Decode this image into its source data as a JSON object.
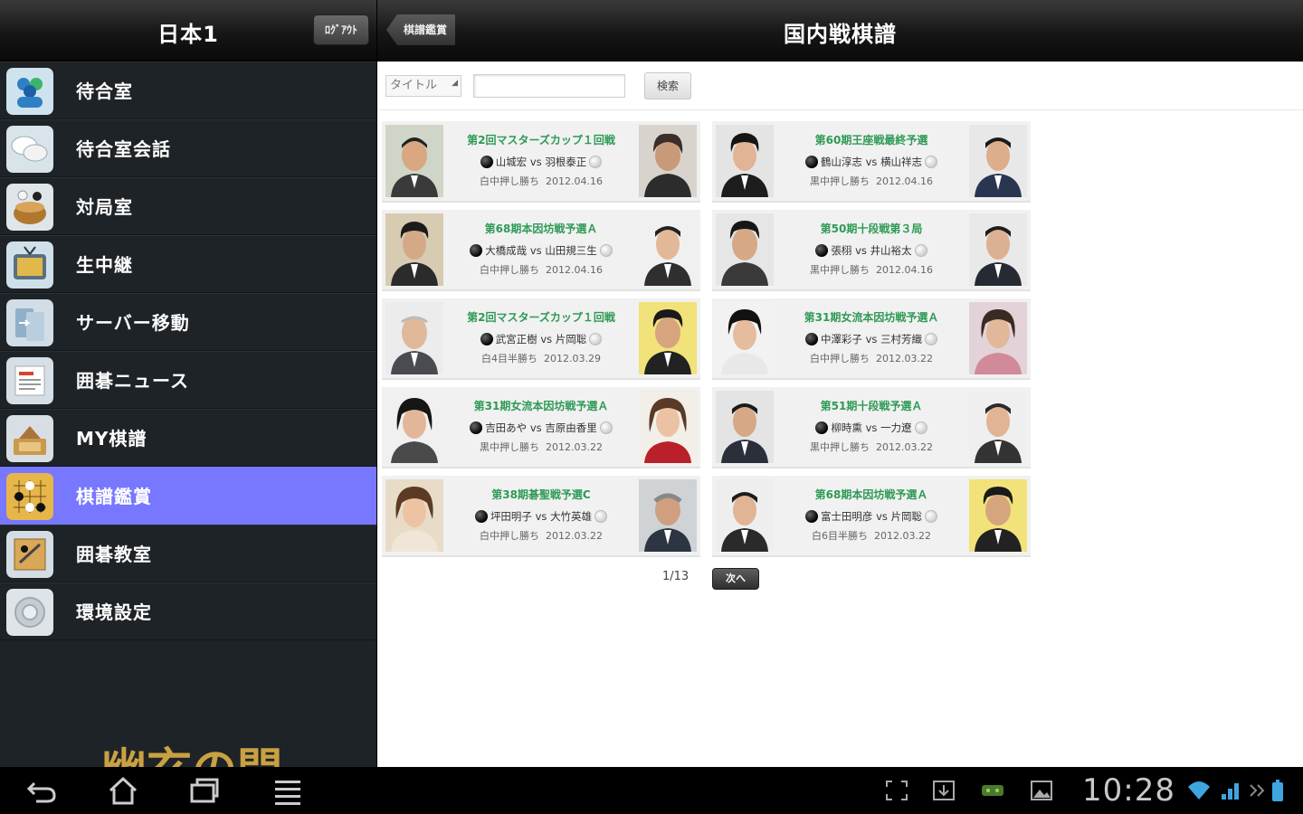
{
  "left_header": {
    "title": "日本1",
    "logout_label": "ﾛｸﾞｱｳﾄ"
  },
  "sidebar": {
    "items": [
      {
        "label": "待合室",
        "icon": "people-icon"
      },
      {
        "label": "待合室会話",
        "icon": "chat-bubbles-icon"
      },
      {
        "label": "対局室",
        "icon": "go-bowl-icon"
      },
      {
        "label": "生中継",
        "icon": "tv-icon"
      },
      {
        "label": "サーバー移動",
        "icon": "server-move-icon"
      },
      {
        "label": "囲碁ニュース",
        "icon": "news-icon"
      },
      {
        "label": "MY棋譜",
        "icon": "my-record-icon"
      },
      {
        "label": "棋譜鑑賞",
        "icon": "go-board-icon",
        "selected": true
      },
      {
        "label": "囲碁教室",
        "icon": "classroom-icon"
      },
      {
        "label": "環境設定",
        "icon": "settings-icon"
      }
    ],
    "brand_logo_text": "幽玄の間",
    "selected_color": "#7777ff"
  },
  "right_header": {
    "back_label": "棋譜鑑賞",
    "title": "国内戦棋譜"
  },
  "search": {
    "select_value": "タイトル",
    "input_value": "",
    "button_label": "検索"
  },
  "games": [
    {
      "title": "第2回マスターズカップ１回戦",
      "black": "山城宏",
      "white": "羽根泰正",
      "result": "白中押し勝ち",
      "date": "2012.04.16"
    },
    {
      "title": "第60期王座戦最終予選",
      "black": "鶴山淳志",
      "white": "横山祥志",
      "result": "黒中押し勝ち",
      "date": "2012.04.16"
    },
    {
      "title": "第68期本因坊戦予選Ａ",
      "black": "大橋成哉",
      "white": "山田規三生",
      "result": "白中押し勝ち",
      "date": "2012.04.16"
    },
    {
      "title": "第50期十段戦第３局",
      "black": "張栩",
      "white": "井山裕太",
      "result": "黒中押し勝ち",
      "date": "2012.04.16"
    },
    {
      "title": "第2回マスターズカップ１回戦",
      "black": "武宮正樹",
      "white": "片岡聡",
      "result": "白4目半勝ち",
      "date": "2012.03.29"
    },
    {
      "title": "第31期女流本因坊戦予選Ａ",
      "black": "中澤彩子",
      "white": "三村芳織",
      "result": "白中押し勝ち",
      "date": "2012.03.22"
    },
    {
      "title": "第31期女流本因坊戦予選Ａ",
      "black": "吉田あや",
      "white": "吉原由香里",
      "result": "黒中押し勝ち",
      "date": "2012.03.22"
    },
    {
      "title": "第51期十段戦予選Ａ",
      "black": "柳時熏",
      "white": "一力遼",
      "result": "黒中押し勝ち",
      "date": "2012.03.22"
    },
    {
      "title": "第38期碁聖戦予選C",
      "black": "坪田明子",
      "white": "大竹英雄",
      "result": "白中押し勝ち",
      "date": "2012.03.22"
    },
    {
      "title": "第68期本因坊戦予選Ａ",
      "black": "富士田明彦",
      "white": "片岡聡",
      "result": "白6目半勝ち",
      "date": "2012.03.22"
    }
  ],
  "vs_label": "vs",
  "pager": {
    "text": "1/13",
    "next_label": "次へ"
  },
  "system_bar": {
    "clock": "10:28"
  }
}
